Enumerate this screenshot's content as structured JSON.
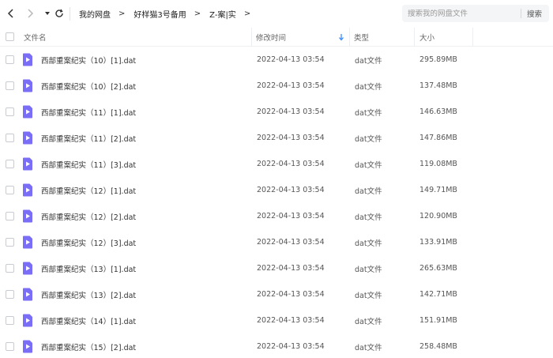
{
  "nav": {
    "back_icon": "chevron-left-icon",
    "forward_icon": "chevron-right-icon",
    "dropdown_icon": "caret-down-icon",
    "refresh_icon": "refresh-icon"
  },
  "breadcrumb": [
    "我的网盘",
    "好样猫3号备用",
    "Z-案|实"
  ],
  "search": {
    "placeholder": "搜索我的网盘文件",
    "button_label": "搜索"
  },
  "table": {
    "headers": {
      "name": "文件名",
      "modified": "修改时间",
      "type": "类型",
      "size": "大小"
    },
    "sort_indicator": "arrow-down-icon",
    "rows": [
      {
        "name": "西部重案纪实（10）[1].dat",
        "modified": "2022-04-13 03:54",
        "type": "dat文件",
        "size": "295.89MB"
      },
      {
        "name": "西部重案纪实（10）[2].dat",
        "modified": "2022-04-13 03:54",
        "type": "dat文件",
        "size": "137.48MB"
      },
      {
        "name": "西部重案纪实（11）[1].dat",
        "modified": "2022-04-13 03:54",
        "type": "dat文件",
        "size": "146.63MB"
      },
      {
        "name": "西部重案纪实（11）[2].dat",
        "modified": "2022-04-13 03:54",
        "type": "dat文件",
        "size": "147.86MB"
      },
      {
        "name": "西部重案纪实（11）[3].dat",
        "modified": "2022-04-13 03:54",
        "type": "dat文件",
        "size": "119.08MB"
      },
      {
        "name": "西部重案纪实（12）[1].dat",
        "modified": "2022-04-13 03:54",
        "type": "dat文件",
        "size": "149.71MB"
      },
      {
        "name": "西部重案纪实（12）[2].dat",
        "modified": "2022-04-13 03:54",
        "type": "dat文件",
        "size": "120.90MB"
      },
      {
        "name": "西部重案纪实（12）[3].dat",
        "modified": "2022-04-13 03:54",
        "type": "dat文件",
        "size": "133.91MB"
      },
      {
        "name": "西部重案纪实（13）[1].dat",
        "modified": "2022-04-13 03:54",
        "type": "dat文件",
        "size": "265.63MB"
      },
      {
        "name": "西部重案纪实（13）[2].dat",
        "modified": "2022-04-13 03:54",
        "type": "dat文件",
        "size": "142.71MB"
      },
      {
        "name": "西部重案纪实（14）[1].dat",
        "modified": "2022-04-13 03:54",
        "type": "dat文件",
        "size": "151.91MB"
      },
      {
        "name": "西部重案纪实（15）[2].dat",
        "modified": "2022-04-13 03:54",
        "type": "dat文件",
        "size": "258.48MB"
      }
    ]
  },
  "colors": {
    "file_icon": "#7b6ef6",
    "sort_arrow": "#3b8cff"
  }
}
